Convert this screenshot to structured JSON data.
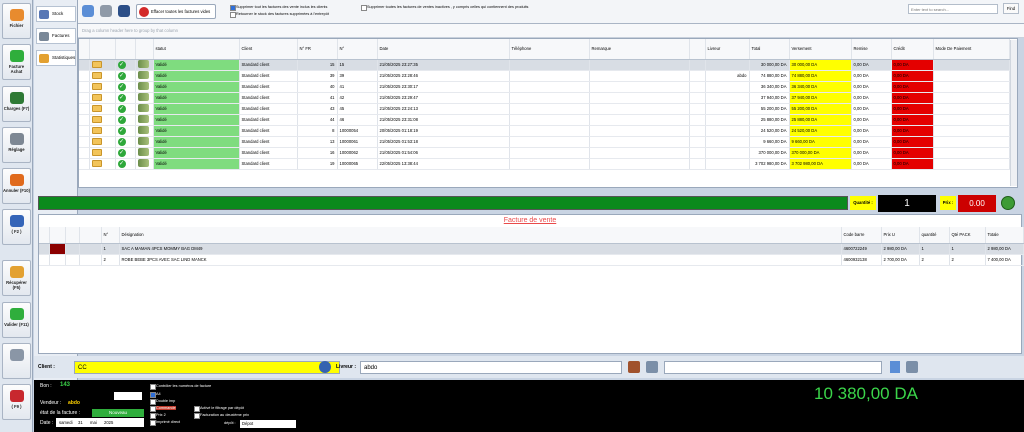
{
  "sidebar": {
    "buttons": [
      {
        "label": "Fichier",
        "icon": "folder-icon",
        "color": "#e88b2e"
      },
      {
        "label": "Facture Achat",
        "icon": "add-icon",
        "color": "#2fae3c"
      },
      {
        "label": "Charges (F7)",
        "icon": "money-icon",
        "color": "#2f7a35"
      },
      {
        "label": "Réglage",
        "icon": "gear-icon",
        "color": "#7d8793"
      },
      {
        "label": "Annuler (F10)",
        "icon": "cancel-icon",
        "color": "#e06a1c"
      },
      {
        "label": "( F2 )",
        "icon": "document-icon",
        "color": "#3565b8"
      },
      {
        "label": "Récupérer (F5)",
        "icon": "folder-icon",
        "color": "#e3a131"
      },
      {
        "label": "Valider (F11)",
        "icon": "check-icon",
        "color": "#2fae3c"
      },
      {
        "label": "",
        "icon": "printer-icon",
        "color": "#8a96a6"
      },
      {
        "label": "( F9 )",
        "icon": "power-icon",
        "color": "#c8282e"
      }
    ]
  },
  "nav": {
    "items": [
      {
        "label": "Stock",
        "icon": "stock-icon"
      },
      {
        "label": "Factures",
        "icon": "invoice-icon"
      },
      {
        "label": "Statistiques",
        "icon": "stats-icon"
      }
    ]
  },
  "toolbar": {
    "clear_label": "Effacer toutes les factures vides",
    "option1": "Supprimer tout les factures des vente inclus les clients  ",
    "option2": "Supprimer toutes les factures de ventes inactives , y compris celles qui contiennent des produits",
    "option3": "Retourner le stock des factures supprimées à l'entrepôt",
    "search_placeholder": "Enter text to search...",
    "find_label": "Find",
    "group_hint": "Drag a column header here to group by that column"
  },
  "invoices": {
    "columns": [
      "",
      "",
      "",
      "",
      "statut",
      "Client",
      "N° FR",
      "N°",
      "Date",
      "Téléphone",
      "Remarque",
      "",
      "Livreur",
      "Total",
      "Versement",
      "Remise",
      "Crédit",
      "Mode De Paiement"
    ],
    "rows": [
      {
        "statut": "Validé",
        "client": "Standard client",
        "nfr": "15",
        "n": "15",
        "date": "21/05/2025 23:27:35",
        "livreur": "",
        "total": "30 000,00 DA",
        "versement": "30 000,00 DA",
        "remise": "0,00 DA",
        "credit": "0,00 DA"
      },
      {
        "statut": "Validé",
        "client": "Standard client",
        "nfr": "39",
        "n": "39",
        "date": "21/05/2025 23:28:46",
        "livreur": "abdo",
        "total": "74 880,00 DA",
        "versement": "74 880,00 DA",
        "remise": "0,00 DA",
        "credit": "0,00 DA"
      },
      {
        "statut": "Validé",
        "client": "Standard client",
        "nfr": "40",
        "n": "41",
        "date": "21/05/2025 23:30:17",
        "livreur": "",
        "total": "36 340,00 DA",
        "versement": "36 340,00 DA",
        "remise": "0,00 DA",
        "credit": "0,00 DA"
      },
      {
        "statut": "Validé",
        "client": "Standard client",
        "nfr": "41",
        "n": "42",
        "date": "21/05/2025 23:29:47",
        "livreur": "",
        "total": "37 940,00 DA",
        "versement": "37 940,00 DA",
        "remise": "0,00 DA",
        "credit": "0,00 DA"
      },
      {
        "statut": "Validé",
        "client": "Standard client",
        "nfr": "43",
        "n": "45",
        "date": "21/05/2025 23:24:13",
        "livreur": "",
        "total": "55 200,00 DA",
        "versement": "55 200,00 DA",
        "remise": "0,00 DA",
        "credit": "0,00 DA"
      },
      {
        "statut": "Validé",
        "client": "Standard client",
        "nfr": "44",
        "n": "46",
        "date": "21/05/2025 23:31:08",
        "livreur": "",
        "total": "25 880,00 DA",
        "versement": "25 880,00 DA",
        "remise": "0,00 DA",
        "credit": "0,00 DA"
      },
      {
        "statut": "Validé",
        "client": "Standard client",
        "nfr": "8",
        "n": "10000054",
        "date": "20/05/2025 01:18:19",
        "livreur": "",
        "total": "24 520,00 DA",
        "versement": "24 520,00 DA",
        "remise": "0,00 DA",
        "credit": "0,00 DA"
      },
      {
        "statut": "Validé",
        "client": "Standard client",
        "nfr": "13",
        "n": "10000061",
        "date": "21/05/2025 01:53:18",
        "livreur": "",
        "total": "9 660,00 DA",
        "versement": "9 660,00 DA",
        "remise": "0,00 DA",
        "credit": "0,00 DA"
      },
      {
        "statut": "Validé",
        "client": "Standard client",
        "nfr": "16",
        "n": "10000062",
        "date": "21/05/2025 01:54:06",
        "livreur": "",
        "total": "370 000,00 DA",
        "versement": "370 000,00 DA",
        "remise": "0,00 DA",
        "credit": "0,00 DA"
      },
      {
        "statut": "Validé",
        "client": "Standard client",
        "nfr": "19",
        "n": "10000065",
        "date": "22/05/2025 13:38:44",
        "livreur": "",
        "total": "3 702 980,00 DA",
        "versement": "3 702 980,00 DA",
        "remise": "0,00 DA",
        "credit": "0,00 DA"
      }
    ]
  },
  "status": {
    "qty_label": "Quantité :",
    "qty_value": "1",
    "price_label": "Prix :",
    "price_value": "0.00"
  },
  "invoice": {
    "title": "Facture de vente",
    "columns": [
      "",
      "",
      "",
      "",
      "N°",
      "Désignation",
      "Code barre",
      "Prix U",
      "quantité",
      "Qté PACK",
      "Totale"
    ],
    "lines": [
      {
        "n": "1",
        "designation": "SAC A MAMAN 4PCS MOMMY BAG DM49",
        "code": "4600722249",
        "prix": "2 980,00 DA",
        "qte": "1",
        "pack": "1",
        "total": "2 980,00 DA"
      },
      {
        "n": "2",
        "designation": "ROBE BEBE 3PCS AVEC SAC LIND MANCK",
        "code": "4600932138",
        "prix": "2 700,00 DA",
        "qte": "2",
        "pack": "2",
        "total": "7 400,00 DA"
      }
    ]
  },
  "client": {
    "client_label": "Client :",
    "client_value": "CC",
    "livreur_label": "Livreur :",
    "livreur_value": "abdo"
  },
  "bottom": {
    "bon_label": "Bon :",
    "bon_value": "143",
    "vendeur_label": "Vendeur :",
    "vendeur_value": "abdo",
    "etat_label": "état de la facture :",
    "etat_value": "Nouveau",
    "date_label": "Date :",
    "date_day": "samedi",
    "date_num": "31",
    "date_month": "mai",
    "date_year": "2025",
    "options": [
      {
        "label": "Contrôler les numéros de facture",
        "checked": false
      },
      {
        "label": "A4",
        "checked": true
      },
      {
        "label": "Double imp",
        "checked": false
      },
      {
        "label": "Commande",
        "checked": false
      },
      {
        "label": "Activé le filtrage par dépôt",
        "checked": false
      },
      {
        "label": "Prix 2",
        "checked": false
      },
      {
        "label": "Facturation au deuxième prix",
        "checked": false
      },
      {
        "label": "Imprimé direct",
        "checked": false
      }
    ],
    "depot_label": "dépôt :",
    "depot_value": "Dépot",
    "total": "10 380,00 DA"
  }
}
